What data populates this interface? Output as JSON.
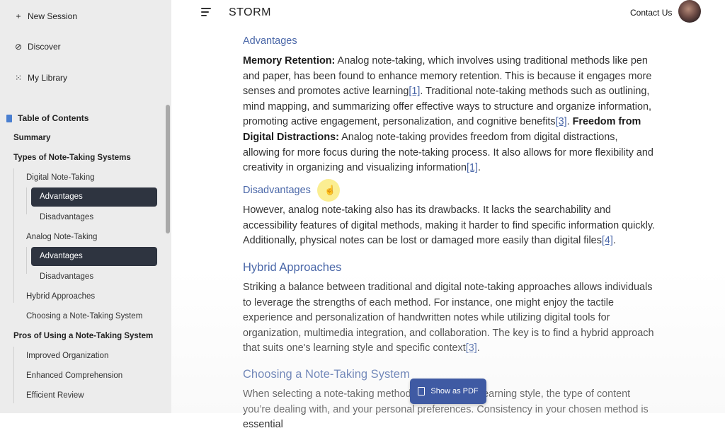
{
  "app": {
    "title": "STORM",
    "contact_label": "Contact Us"
  },
  "nav": {
    "new_session": "New Session",
    "discover": "Discover",
    "my_library": "My Library"
  },
  "toc": {
    "title": "Table of Contents",
    "items": [
      {
        "label": "Summary"
      },
      {
        "label": "Types of Note-Taking Systems"
      },
      {
        "label": "Digital Note-Taking"
      },
      {
        "label": "Advantages"
      },
      {
        "label": "Disadvantages"
      },
      {
        "label": "Analog Note-Taking"
      },
      {
        "label": "Advantages"
      },
      {
        "label": "Disadvantages"
      },
      {
        "label": "Hybrid Approaches"
      },
      {
        "label": "Choosing a Note-Taking System"
      },
      {
        "label": "Pros of Using a Note-Taking System"
      },
      {
        "label": "Improved Organization"
      },
      {
        "label": "Enhanced Comprehension"
      },
      {
        "label": "Efficient Review"
      }
    ]
  },
  "article": {
    "advantages_heading": "Advantages",
    "adv": {
      "b1": "Memory Retention:",
      "t1": " Analog note-taking, which involves using traditional methods like pen and paper, has been found to enhance memory retention. This is because it engages more senses and promotes active learning",
      "c1": "[1]",
      "t2": ". Traditional note-taking methods such as outlining, mind mapping, and summarizing offer effective ways to structure and organize information, promoting active engagement, personalization, and cognitive benefits",
      "c2": "[3]",
      "t3": ". ",
      "b2": "Freedom from Digital Distractions:",
      "t4": " Analog note-taking provides freedom from digital distractions, allowing for more focus during the note-taking process. It also allows for more flexibility and creativity in organizing and visualizing information",
      "c3": "[1]",
      "t5": "."
    },
    "disadvantages_heading": "Disadvantages",
    "dis": {
      "t1": "However, analog note-taking also has its drawbacks. It lacks the searchability and accessibility features of digital methods, making it harder to find specific information quickly. Additionally, physical notes can be lost or damaged more easily than digital files",
      "c1": "[4]",
      "t2": "."
    },
    "hybrid_heading": "Hybrid Approaches",
    "hyb": {
      "t1": "Striking a balance between traditional and digital note-taking approaches allows individuals to leverage the strengths of each method. For instance, one might enjoy the tactile experience and personalization of handwritten notes while utilizing digital tools for organization, multimedia integration, and collaboration. The key is to find a hybrid approach that suits one's learning style and specific context",
      "c1": "[3]",
      "t2": "."
    },
    "choosing_heading": "Choosing a Note-Taking System",
    "cho": {
      "t1": "When selecting a note-taking method, consider your learning style, the type of content you’re dealing with, and your personal preferences. Consistency in your chosen method is essential"
    }
  },
  "pdf_button": "Show as PDF",
  "colors": {
    "accent": "#4a67a8",
    "active_bg": "#2e3440",
    "sidebar_bg": "#ececec",
    "button_bg": "#3f5aa3"
  }
}
